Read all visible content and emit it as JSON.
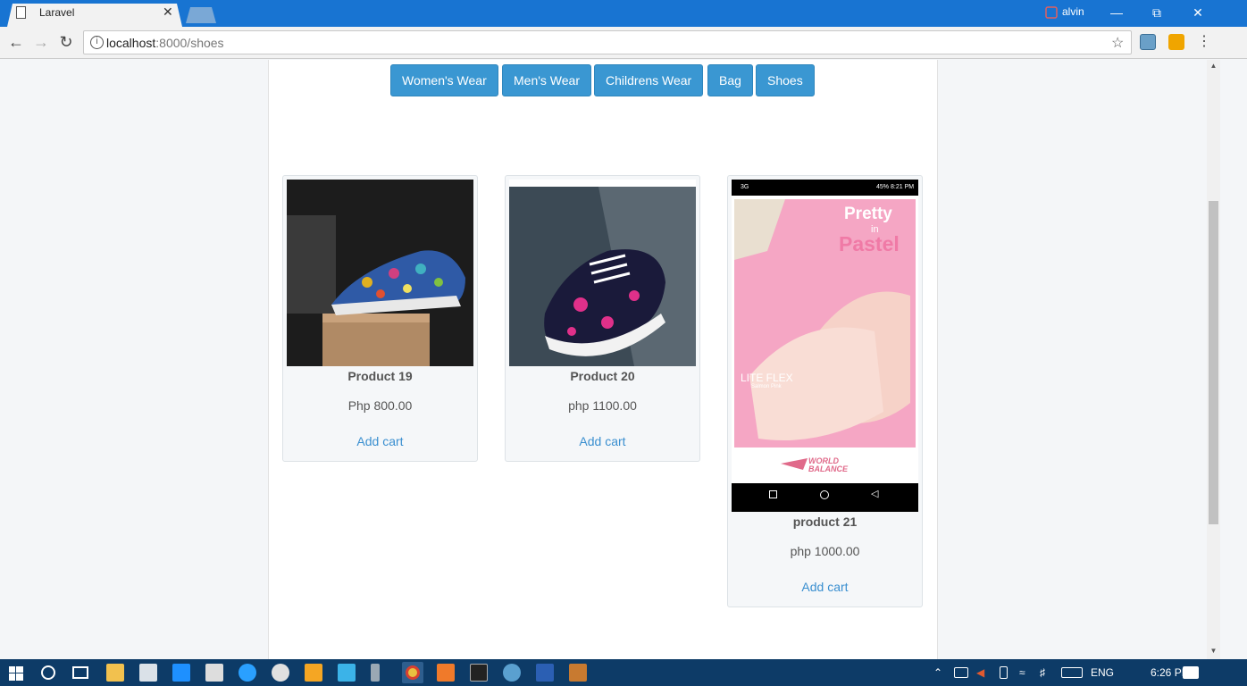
{
  "browser": {
    "tab_title": "Laravel",
    "tab_close": "✕",
    "user": "alvin",
    "url_host": "localhost",
    "url_path": ":8000/shoes",
    "info": "i"
  },
  "categories": [
    {
      "label": "Women's Wear"
    },
    {
      "label": "Men's Wear"
    },
    {
      "label": "Childrens Wear"
    },
    {
      "label": "Bag"
    },
    {
      "label": "Shoes"
    }
  ],
  "products": [
    {
      "name": "Product 19",
      "price": "Php 800.00",
      "cart": "Add cart"
    },
    {
      "name": "Product 20",
      "price": "php 1100.00",
      "cart": "Add cart"
    },
    {
      "name": "product 21",
      "price": "php 1000.00",
      "cart": "Add cart"
    }
  ],
  "product21_image": {
    "status_time": "8:21 PM",
    "status_net": "3G",
    "status_battery": "45%",
    "headline_1": "Pretty",
    "headline_2": "in",
    "headline_3": "Pastel",
    "product_title": "LITE FLEX",
    "product_sub": "Salmon Pink",
    "brand": "WORLD BALANCE"
  },
  "taskbar": {
    "lang": "ENG",
    "time": "6:26 PM"
  },
  "colors": {
    "accent": "#3a97d2",
    "titlebar": "#1874d2",
    "taskbar": "#0d3b67",
    "link": "#3a8fd0"
  }
}
